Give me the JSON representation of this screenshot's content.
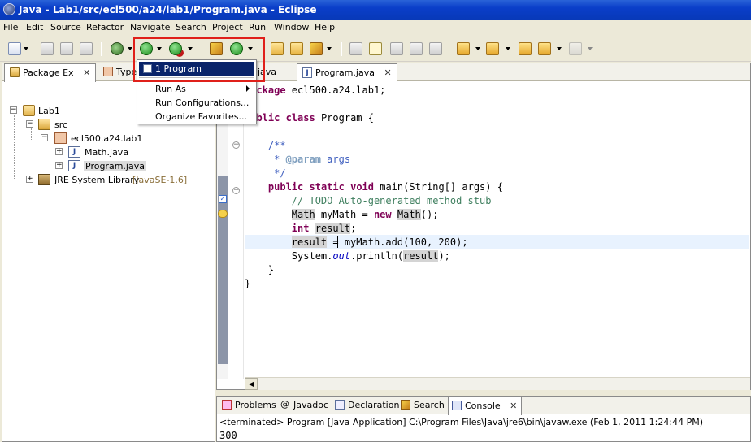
{
  "window": {
    "title": "Java - Lab1/src/ecl500/a24/lab1/Program.java - Eclipse"
  },
  "menubar": [
    "File",
    "Edit",
    "Source",
    "Refactor",
    "Navigate",
    "Search",
    "Project",
    "Run",
    "Window",
    "Help"
  ],
  "toolbar": {
    "icons": [
      "new-wizard-icon",
      "save-icon",
      "save-all-icon",
      "print-icon",
      "debug-icon",
      "run-icon",
      "external-tools-icon",
      "new-java-project-icon",
      "new-class-icon",
      "open-type-icon",
      "open-folder-icon",
      "brush-icon",
      "next-annotation-icon",
      "mark-occurrences-icon",
      "show-whitespace-icon",
      "block-selection-icon",
      "pilcrow-icon",
      "next-edit-icon",
      "previous-edit-icon",
      "back-icon",
      "forward-icon"
    ],
    "highlight_color": "#e0201a"
  },
  "run_menu": {
    "items": [
      {
        "label": "1 Program",
        "highlighted": true
      },
      {
        "label": "Run As",
        "submenu": true
      },
      {
        "label": "Run Configurations..."
      },
      {
        "label": "Organize Favorites..."
      }
    ]
  },
  "package_explorer": {
    "tabs": [
      {
        "label": "Package Ex",
        "active": true
      },
      {
        "label": "Type"
      }
    ],
    "tree": {
      "project": "Lab1",
      "src": "src",
      "package": "ecl500.a24.lab1",
      "file1": "Math.java",
      "file2": "Program.java",
      "lib_name": "JRE System Library",
      "lib_version": "[JavaSE-1.6]"
    }
  },
  "editor": {
    "tabs": [
      {
        "label": "java"
      },
      {
        "label": "Program.java",
        "active": true
      }
    ]
  },
  "console": {
    "tabs": [
      "Problems",
      "Javadoc",
      "Declaration",
      "Search",
      "Console"
    ],
    "status": "<terminated> Program [Java Application] C:\\Program Files\\Java\\jre6\\bin\\javaw.exe (Feb 1, 2011 1:24:44 PM)",
    "output": "300"
  }
}
